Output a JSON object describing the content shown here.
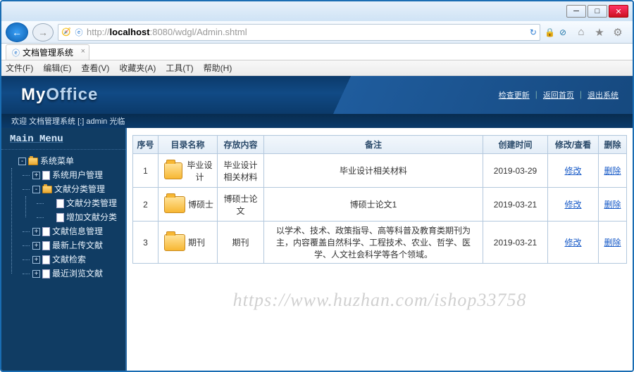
{
  "window": {
    "url_prefix": "http://",
    "url_host": "localhost",
    "url_rest": ":8080/wdgl/Admin.shtml"
  },
  "browser_tab": {
    "title": "文档管理系统"
  },
  "menubar": {
    "file": "文件(F)",
    "edit": "编辑(E)",
    "view": "查看(V)",
    "fav": "收藏夹(A)",
    "tools": "工具(T)",
    "help": "帮助(H)"
  },
  "header": {
    "logo_main": "My",
    "logo_sub": "Office",
    "links": {
      "a": "检查更新",
      "b": "返回首页",
      "c": "退出系统"
    }
  },
  "welcome": "欢迎 文档管理系统 [:] admin 光临",
  "sidebar": {
    "title": "Main Menu",
    "root": "系统菜单",
    "items": [
      {
        "label": "系统用户管理",
        "leaf": true,
        "file": true
      },
      {
        "label": "文献分类管理",
        "leaf": false,
        "file": false,
        "children": [
          {
            "label": "文献分类管理",
            "file": true
          },
          {
            "label": "增加文献分类",
            "file": true
          }
        ]
      },
      {
        "label": "文献信息管理",
        "leaf": true,
        "file": true
      },
      {
        "label": "最新上传文献",
        "leaf": true,
        "file": true
      },
      {
        "label": "文献检索",
        "leaf": true,
        "file": true
      },
      {
        "label": "最近浏览文献",
        "leaf": true,
        "file": true
      }
    ]
  },
  "table": {
    "headers": {
      "seq": "序号",
      "name": "目录名称",
      "store": "存放内容",
      "remark": "备注",
      "time": "创建时间",
      "mod": "修改/查看",
      "del": "删除"
    },
    "rows": [
      {
        "seq": "1",
        "name": "毕业设计",
        "store": "毕业设计相关材料",
        "remark": "毕业设计相关材料",
        "time": "2019-03-29",
        "mod": "修改",
        "del": "删除"
      },
      {
        "seq": "2",
        "name": "博硕士",
        "store": "博硕士论文",
        "remark": "博硕士论文1",
        "time": "2019-03-21",
        "mod": "修改",
        "del": "删除"
      },
      {
        "seq": "3",
        "name": "期刊",
        "store": "期刊",
        "remark": "以学术、技术、政策指导、高等科普及教育类期刊为主，内容覆盖自然科学、工程技术、农业、哲学、医学、人文社会科学等各个领域。",
        "time": "2019-03-21",
        "mod": "修改",
        "del": "删除"
      }
    ]
  },
  "watermark": "https://www.huzhan.com/ishop33758"
}
